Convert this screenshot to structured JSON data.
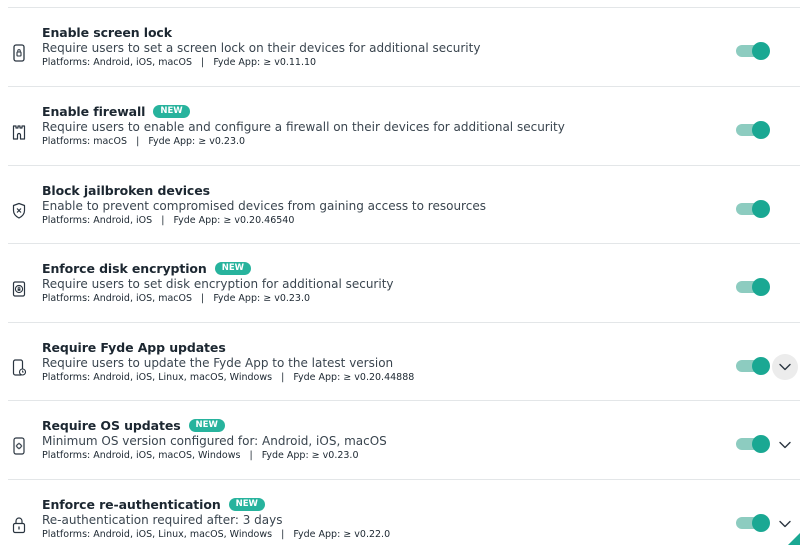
{
  "colors": {
    "accent": "#1aa893",
    "badge": "#27b39d",
    "divider": "#e3e6e8"
  },
  "policies": [
    {
      "title": "Enable screen lock",
      "badge": "",
      "description": "Require users to set a screen lock on their devices for additional security",
      "platforms": "Platforms: Android, iOS, macOS",
      "app": "Fyde App: ≥ v0.11.10",
      "icon": "phone-lock-icon",
      "enabled": true,
      "expandable": false
    },
    {
      "title": "Enable firewall",
      "badge": "NEW",
      "description": "Require users to enable and configure a firewall on their devices for additional security",
      "platforms": "Platforms: macOS",
      "app": "Fyde App: ≥ v0.23.0",
      "icon": "castle-wall-icon",
      "enabled": true,
      "expandable": false
    },
    {
      "title": "Block jailbroken devices",
      "badge": "",
      "description": "Enable to prevent compromised devices from gaining access to resources",
      "platforms": "Platforms: Android, iOS",
      "app": "Fyde App: ≥ v0.20.46540",
      "icon": "shield-x-icon",
      "enabled": true,
      "expandable": false
    },
    {
      "title": "Enforce disk encryption",
      "badge": "NEW",
      "description": "Require users to set disk encryption for additional security",
      "platforms": "Platforms: Android, iOS, macOS",
      "app": "Fyde App: ≥ v0.23.0",
      "icon": "disk-lock-icon",
      "enabled": true,
      "expandable": false
    },
    {
      "title": "Require Fyde App updates",
      "badge": "",
      "description": "Require users to update the Fyde App to the latest version",
      "platforms": "Platforms: Android, iOS, Linux, macOS, Windows",
      "app": "Fyde App: ≥ v0.20.44888",
      "icon": "phone-update-icon",
      "enabled": true,
      "expandable": true
    },
    {
      "title": "Require OS updates",
      "badge": "NEW",
      "description": "Minimum OS version configured for: Android, iOS, macOS",
      "platforms": "Platforms: Android, iOS, macOS, Windows",
      "app": "Fyde App: ≥ v0.23.0",
      "icon": "phone-settings-icon",
      "enabled": true,
      "expandable": true
    },
    {
      "title": "Enforce re-authentication",
      "badge": "NEW",
      "description": "Re-authentication required after: 3 days",
      "platforms": "Platforms: Android, iOS, Linux, macOS, Windows",
      "app": "Fyde App: ≥ v0.22.0",
      "icon": "padlock-icon",
      "enabled": true,
      "expandable": true
    }
  ]
}
